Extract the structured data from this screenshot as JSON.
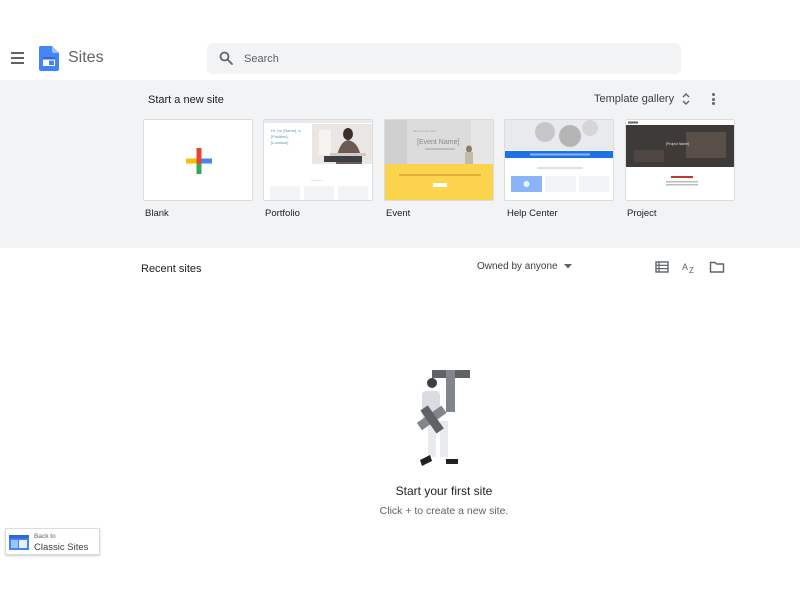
{
  "app": {
    "name": "Sites"
  },
  "search": {
    "placeholder": "Search"
  },
  "start": {
    "title": "Start a new site",
    "gallery_label": "Template gallery",
    "templates": [
      {
        "label": "Blank"
      },
      {
        "label": "Portfolio",
        "preview_text": "Hi, I'm [Name], a [Position], [Location]"
      },
      {
        "label": "Event",
        "preview_text": "[Event Name]"
      },
      {
        "label": "Help Center"
      },
      {
        "label": "Project",
        "preview_text": "[Project Name]"
      }
    ]
  },
  "recent": {
    "title": "Recent sites",
    "owner_filter": "Owned by anyone"
  },
  "empty": {
    "title": "Start your first site",
    "subtitle": "Click + to create a new site."
  },
  "classic": {
    "small": "Back to",
    "big": "Classic Sites"
  },
  "colors": {
    "brand": "#4285f4",
    "panel_bg": "#f1f3f4",
    "plus_red": "#ea4335",
    "plus_yellow": "#fbbc04",
    "plus_green": "#34a853",
    "plus_blue": "#4285f4"
  },
  "icons": {
    "menu": "hamburger-menu-icon",
    "search": "search-icon",
    "sort": "unfold-icon",
    "more": "more-vert-icon",
    "list_view": "list-view-icon",
    "sort_az": "sort-az-icon",
    "folder": "folder-icon"
  }
}
